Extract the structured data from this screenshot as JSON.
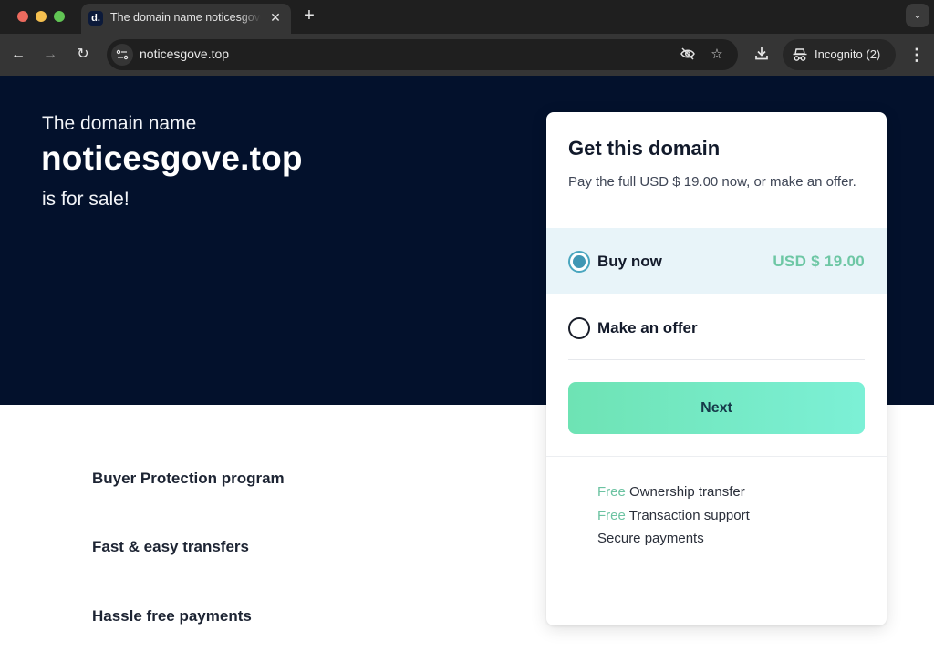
{
  "browser": {
    "tab": {
      "title": "The domain name noticesgove.top is for sale",
      "favicon": "dan-logo-icon"
    },
    "url": "noticesgove.top",
    "incognito_label": "Incognito (2)",
    "icons": {
      "back": "←",
      "forward": "→",
      "reload": "↻",
      "site_info": "⚙",
      "eye_off": "👁",
      "star": "☆",
      "download": "⤓",
      "incognito": "🕵",
      "menu": "⋮",
      "new_tab": "+",
      "close": "✕",
      "tab_search": "⌄"
    }
  },
  "hero": {
    "pre": "The domain name",
    "domain": "noticesgove.top",
    "post": "is for sale!"
  },
  "features": [
    "Buyer Protection program",
    "Fast & easy transfers",
    "Hassle free payments"
  ],
  "card": {
    "title": "Get this domain",
    "subtitle": "Pay the full USD $ 19.00 now, or make an offer.",
    "options": [
      {
        "label": "Buy now",
        "price": "USD $ 19.00",
        "selected": true
      },
      {
        "label": "Make an offer",
        "price": "",
        "selected": false
      }
    ],
    "next_label": "Next",
    "perks": [
      {
        "free": "Free",
        "text": "Ownership transfer"
      },
      {
        "free": "Free",
        "text": "Transaction support"
      },
      {
        "free": "",
        "text": "Secure payments"
      }
    ]
  },
  "colors": {
    "hero_bg": "#03112c",
    "accent_green": "#6ec7a5",
    "button_gradient_start": "#6ee3b4",
    "button_gradient_end": "#7cf0d6",
    "selected_option_bg": "#e8f4f9",
    "radio_checked": "#4097b4"
  }
}
